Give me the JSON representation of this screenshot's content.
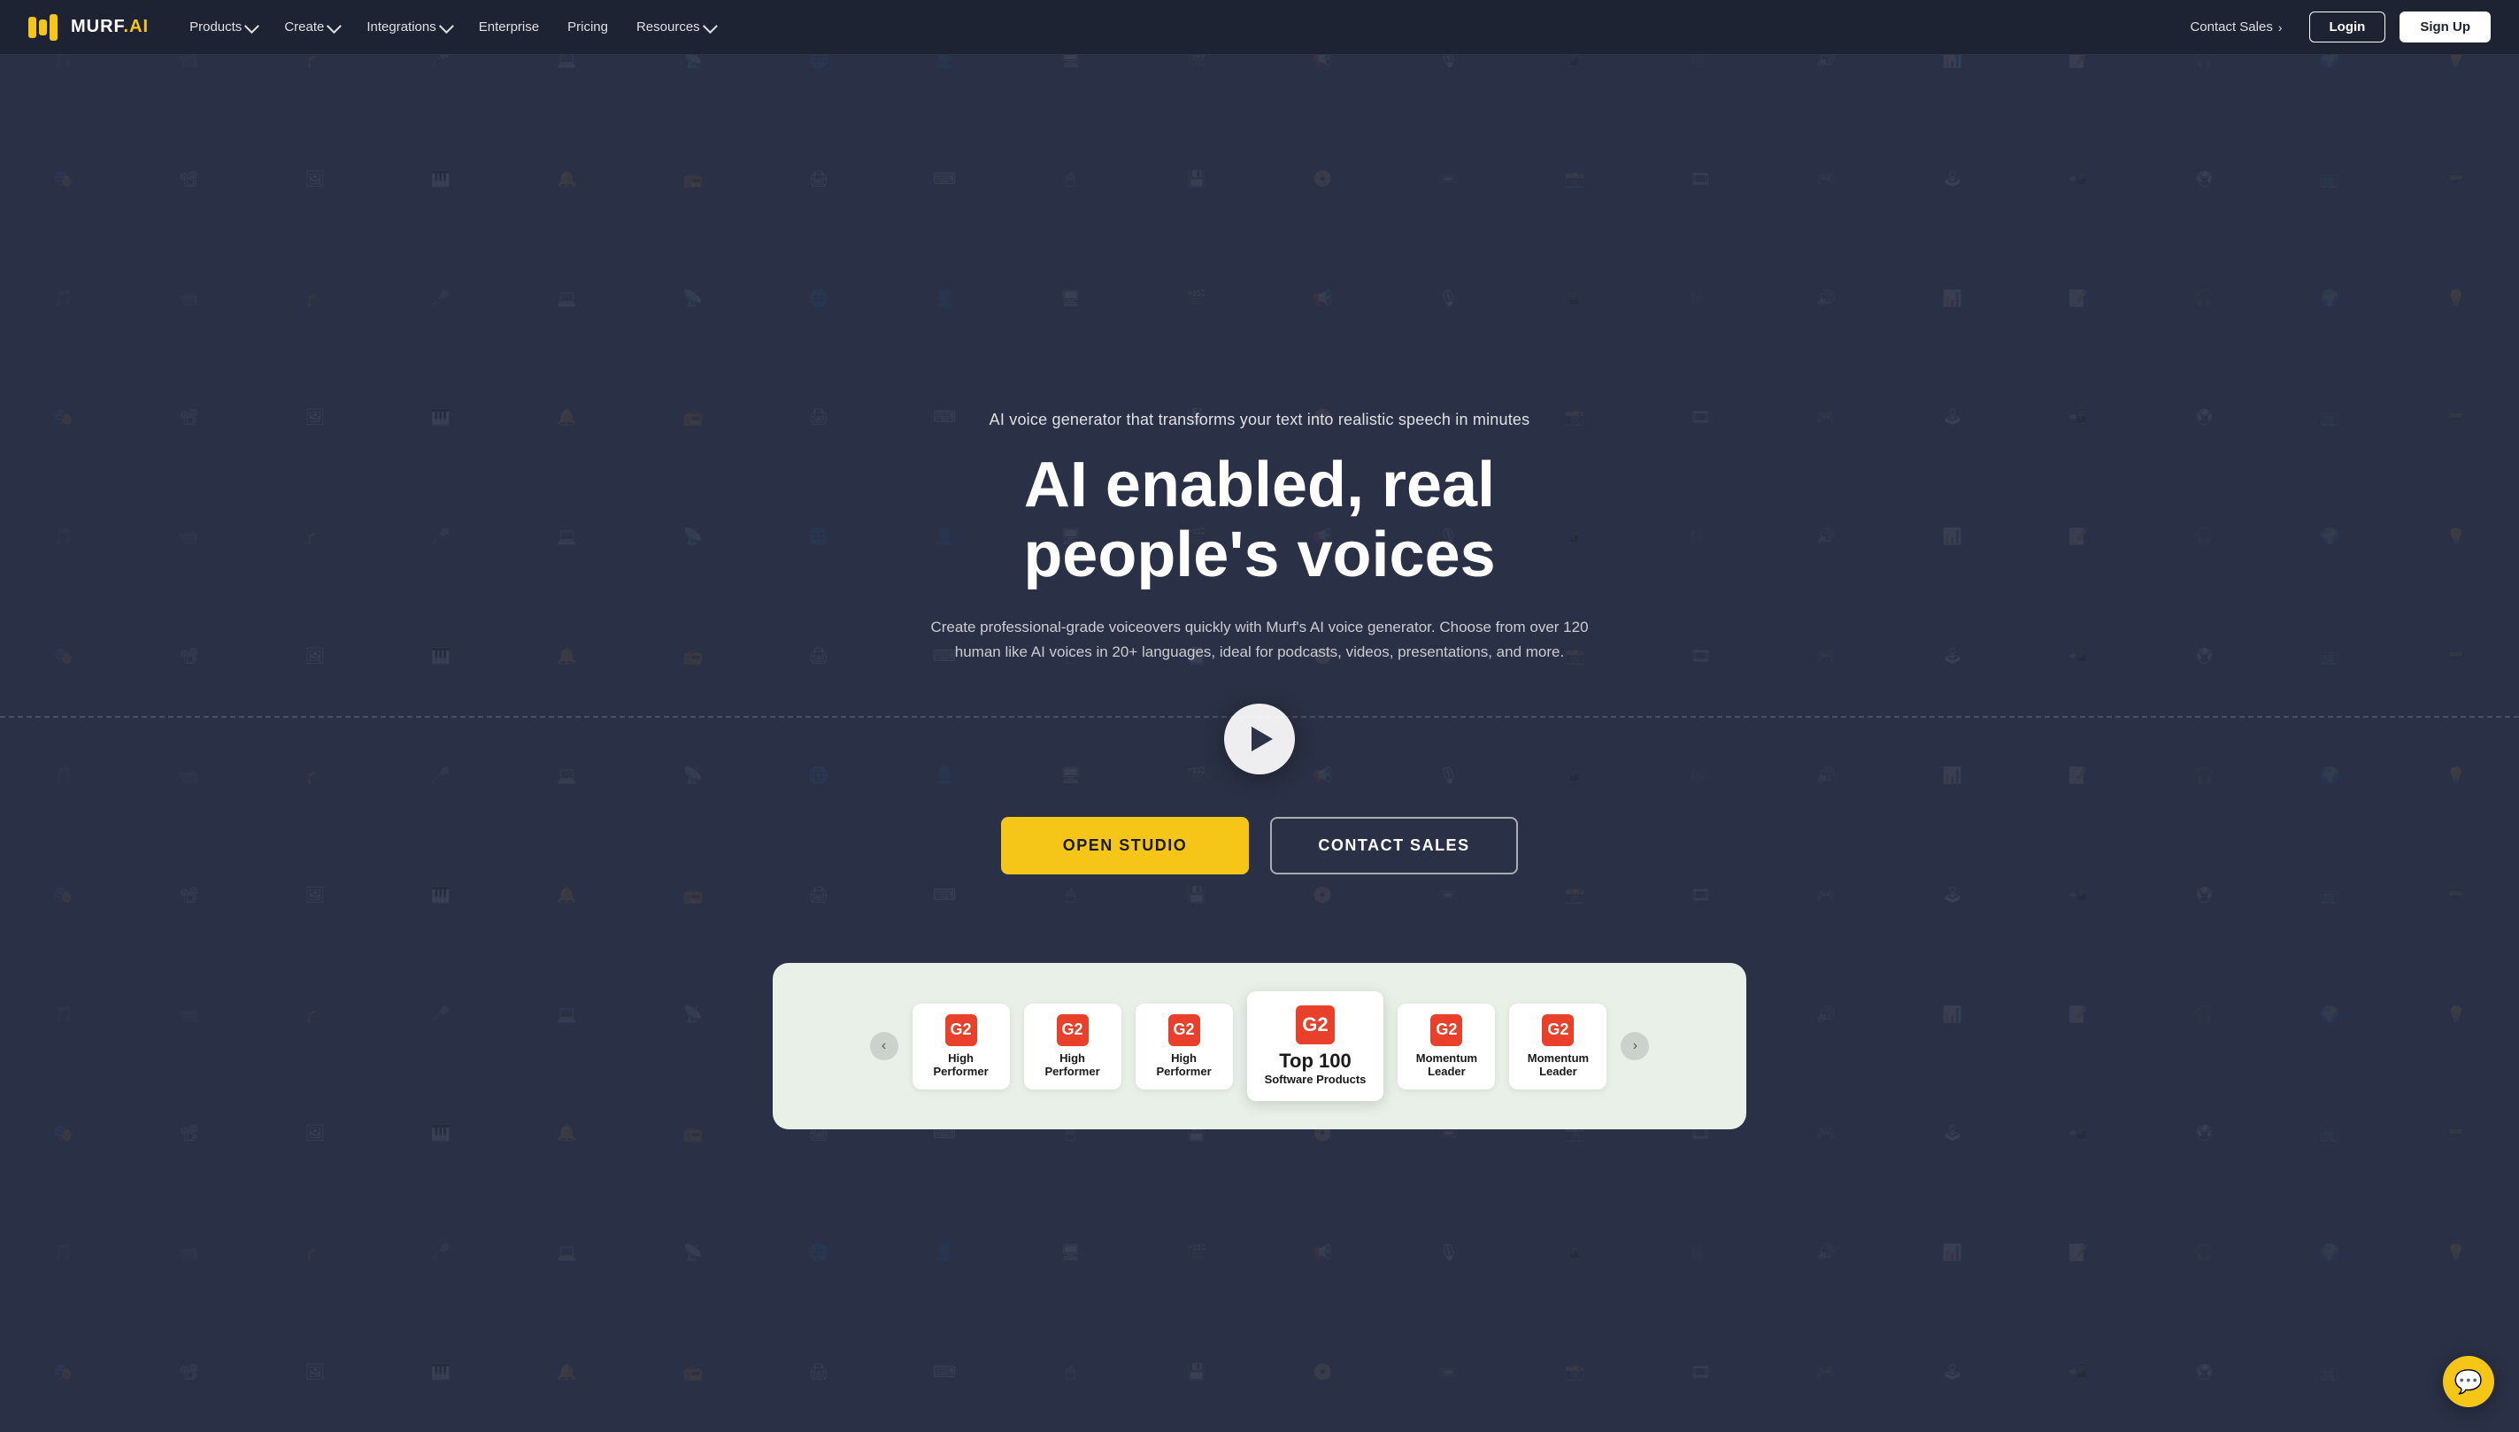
{
  "brand": {
    "name": "MURF",
    "ai_suffix": ".AI",
    "logo_alt": "Murf AI logo"
  },
  "navbar": {
    "products_label": "Products",
    "create_label": "Create",
    "integrations_label": "Integrations",
    "enterprise_label": "Enterprise",
    "pricing_label": "Pricing",
    "resources_label": "Resources",
    "contact_sales_label": "Contact Sales",
    "login_label": "Login",
    "signup_label": "Sign Up"
  },
  "hero": {
    "subtitle": "AI voice generator that transforms your text into realistic speech in minutes",
    "title": "AI enabled, real people's voices",
    "description": "Create professional-grade voiceovers quickly with Murf's AI voice generator. Choose from over 120 human like AI voices in 20+ languages, ideal for podcasts, videos, presentations, and more.",
    "open_studio_label": "OPEN STUDIO",
    "contact_sales_label": "CONTACT SALES",
    "play_button_label": "Play demo"
  },
  "awards": {
    "nav_prev": "‹",
    "nav_next": "›",
    "items": [
      {
        "g2_text": "G2",
        "title": "High\nPerformer"
      },
      {
        "g2_text": "G2",
        "title": "High\nPerformer"
      },
      {
        "g2_text": "G2",
        "title": "High\nPerformer"
      },
      {
        "g2_text": "G2",
        "title": "Top 100",
        "subtitle": "Software Products",
        "featured": true
      },
      {
        "g2_text": "G2",
        "title": "Momentum\nLeader"
      },
      {
        "g2_text": "G2",
        "title": "Momentum\nLeader"
      }
    ]
  },
  "chat": {
    "icon": "💬"
  },
  "bg_icons": [
    "🎵",
    "📹",
    "🎓",
    "🎤",
    "💻",
    "📡",
    "🌐",
    "👤",
    "🖥",
    "🎬",
    "📢",
    "🎙",
    "📱",
    "🎼",
    "🔊",
    "📊",
    "📝",
    "🎧",
    "🌍",
    "💡"
  ]
}
